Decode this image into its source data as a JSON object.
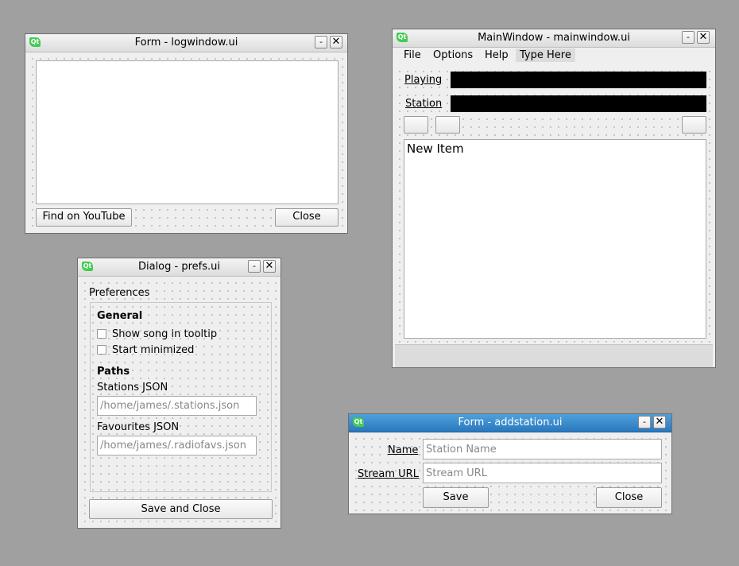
{
  "logwindow": {
    "title": "Form - logwindow.ui",
    "find_button": "Find on YouTube",
    "close_button": "Close"
  },
  "mainwindow": {
    "title": "MainWindow - mainwindow.ui",
    "menu": [
      "File",
      "Options",
      "Help",
      "Type Here"
    ],
    "playing_label": "Playing",
    "station_label": "Station",
    "list_items": [
      "New Item"
    ]
  },
  "prefs": {
    "title": "Dialog - prefs.ui",
    "heading": "Preferences",
    "general_label": "General",
    "show_song_label": "Show song in tooltip",
    "start_minimized_label": "Start minimized",
    "paths_label": "Paths",
    "stations_json_label": "Stations JSON",
    "stations_json_placeholder": "/home/james/.stations.json",
    "favourites_json_label": "Favourites JSON",
    "favourites_json_placeholder": "/home/james/.radiofavs.json",
    "save_close_button": "Save and Close"
  },
  "addstation": {
    "title": "Form - addstation.ui",
    "name_label": "Name",
    "name_placeholder": "Station Name",
    "url_label": "Stream URL",
    "url_placeholder": "Stream URL",
    "save_button": "Save",
    "close_button": "Close"
  },
  "titlebar_buttons": {
    "minimize": "-",
    "close": "✕"
  },
  "colors": {
    "desktop": "#a0a0a0",
    "active_title": "#2a78bd",
    "qt_green": "#41cd52"
  }
}
